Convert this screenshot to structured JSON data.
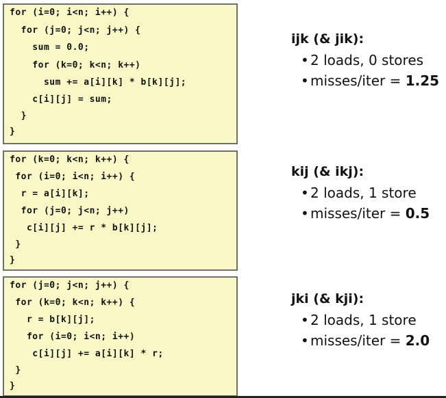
{
  "blocks": [
    {
      "code": [
        "for (i=0; i<n; i++) {",
        "  for (j=0; j<n; j++) {",
        "    sum = 0.0;",
        "    for (k=0; k<n; k++)",
        "      sum += a[i][k] * b[k][j];",
        "    c[i][j] = sum;",
        "  }",
        "}"
      ],
      "title": "ijk (& jik):",
      "loads": "2 loads, 0 stores",
      "misses_label": "misses/iter = ",
      "misses_value": "1.25"
    },
    {
      "code": [
        "for (k=0; k<n; k++) {",
        " for (i=0; i<n; i++) {",
        "  r = a[i][k];",
        "  for (j=0; j<n; j++)",
        "   c[i][j] += r * b[k][j];",
        " }",
        "}"
      ],
      "title": "kij (& ikj):",
      "loads": "2 loads, 1 store",
      "misses_label": "misses/iter = ",
      "misses_value": "0.5"
    },
    {
      "code": [
        "for (j=0; j<n; j++) {",
        " for (k=0; k<n; k++) {",
        "   r = b[k][j];",
        "   for (i=0; i<n; i++)",
        "    c[i][j] += a[i][k] * r;",
        " }",
        "}"
      ],
      "title": "jki (& kji):",
      "loads": "2 loads, 1 store",
      "misses_label": "misses/iter = ",
      "misses_value": "2.0"
    }
  ]
}
